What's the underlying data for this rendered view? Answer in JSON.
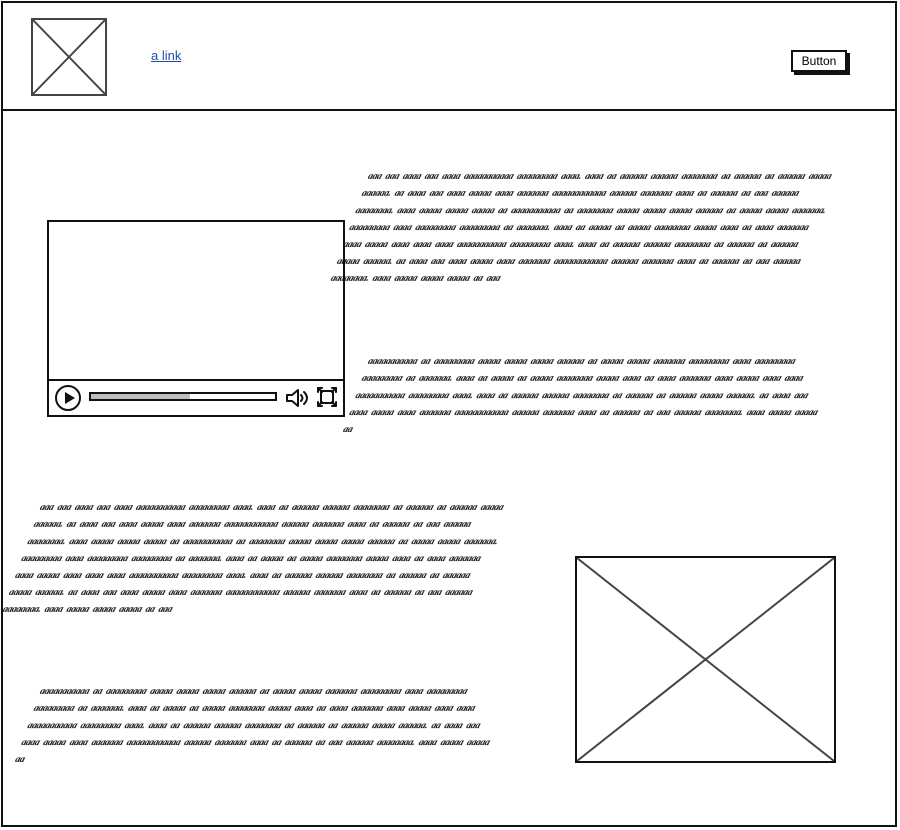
{
  "header": {
    "logo_icon": "image-placeholder-icon",
    "link_text": "a link",
    "button_label": "Button",
    "link_color": "#1f4ea8"
  },
  "video": {
    "progress_fraction": 0.54,
    "play_icon": "play-icon",
    "volume_icon": "volume-icon",
    "fullscreen_icon": "fullscreen-icon"
  },
  "main": {
    "text_blocks": [
      {
        "text": "aaa aaa aaaa aaa aaaa aaaaaaaaaaa aaaaaaaaa aaaa. aaaa aa aaaaaa aaaaaa aaaaaaaa aa aaaaaa aa aaaaaa aaaaa aaaaaa. aa aaaa aaa aaaa aaaaa aaaa aaaaaaa aaaaaaaaaaaa aaaaaa aaaaaaa aaaa aa aaaaaa aa aaa aaaaaa aaaaaaaa. aaaa aaaaa aaaaa aaaaa aa aaaaaaaaaaa aa aaaaaaaa aaaaa aaaaa aaaaa aaaaaa aa aaaaa aaaaa aaaaaaa. aaaaaaaaa aaaa aaaaaaaaa aaaaaaaaa aa aaaaaaa. aaaa aa aaaaa aa aaaaa aaaaaaaa aaaaa aaaa aa aaaa aaaaaaa aaaa aaaaa aaaa aaaa aaaa aaaaaaaaaaa aaaaaaaaa aaaa. aaaa aa aaaaaa aaaaaa aaaaaaaa aa aaaaaa aa aaaaaa aaaaa aaaaaa. aa aaaa aaa aaaa aaaaa aaaa aaaaaaa aaaaaaaaaaaa aaaaaa aaaaaaa aaaa aa aaaaaa aa aaa aaaaaa aaaaaaaa. aaaa aaaaa aaaaa aaaaa aa aaa"
      },
      {
        "text": "aaaaaaaaaaa aa aaaaaaaaa aaaaa aaaaa aaaaa aaaaaa aa aaaaa aaaaa aaaaaaa aaaaaaaaa aaaa aaaaaaaaa aaaaaaaaa aa aaaaaaa. aaaa aa aaaaa aa aaaaa aaaaaaaa aaaaa aaaa aa aaaa aaaaaaa aaaa aaaaa aaaa aaaa aaaaaaaaaaa aaaaaaaaa aaaa. aaaa aa aaaaaa aaaaaa aaaaaaaa aa aaaaaa aa aaaaaa aaaaa aaaaaa. aa aaaa aaa aaaa aaaaa aaaa aaaaaaa aaaaaaaaaaaa aaaaaa aaaaaaa aaaa aa aaaaaa aa aaa aaaaaa aaaaaaaa. aaaa aaaaa aaaaa aa"
      },
      {
        "text": "aaa aaa aaaa aaa aaaa aaaaaaaaaaa aaaaaaaaa aaaa. aaaa aa aaaaaa aaaaaa aaaaaaaa aa aaaaaa aa aaaaaa aaaaa aaaaaa. aa aaaa aaa aaaa aaaaa aaaa aaaaaaa aaaaaaaaaaaa aaaaaa aaaaaaa aaaa aa aaaaaa aa aaa aaaaaa aaaaaaaa. aaaa aaaaa aaaaa aaaaa aa aaaaaaaaaaa aa aaaaaaaa aaaaa aaaaa aaaaa aaaaaa aa aaaaa aaaaa aaaaaaa. aaaaaaaaa aaaa aaaaaaaaa aaaaaaaaa aa aaaaaaa. aaaa aa aaaaa aa aaaaa aaaaaaaa aaaaa aaaa aa aaaa aaaaaaa aaaa aaaaa aaaa aaaa aaaa aaaaaaaaaaa aaaaaaaaa aaaa. aaaa aa aaaaaa aaaaaa aaaaaaaa aa aaaaaa aa aaaaaa aaaaa aaaaaa. aa aaaa aaa aaaa aaaaa aaaa aaaaaaa aaaaaaaaaaaa aaaaaa aaaaaaa aaaa aa aaaaaa aa aaa aaaaaa aaaaaaaa. aaaa aaaaa aaaaa aaaaa aa aaa"
      },
      {
        "text": "aaaaaaaaaaa aa aaaaaaaaa aaaaa aaaaa aaaaa aaaaaa aa aaaaa aaaaa aaaaaaa aaaaaaaaa aaaa aaaaaaaaa aaaaaaaaa aa aaaaaaa. aaaa aa aaaaa aa aaaaa aaaaaaaa aaaaa aaaa aa aaaa aaaaaaa aaaa aaaaa aaaa aaaa aaaaaaaaaaa aaaaaaaaa aaaa. aaaa aa aaaaaa aaaaaa aaaaaaaa aa aaaaaa aa aaaaaa aaaaa aaaaaa. aa aaaa aaa aaaa aaaaa aaaa aaaaaaa aaaaaaaaaaaa aaaaaa aaaaaaa aaaa aa aaaaaa aa aaa aaaaaa aaaaaaaa. aaaa aaaaa aaaaa aa"
      }
    ],
    "image_icon": "image-placeholder-icon"
  }
}
